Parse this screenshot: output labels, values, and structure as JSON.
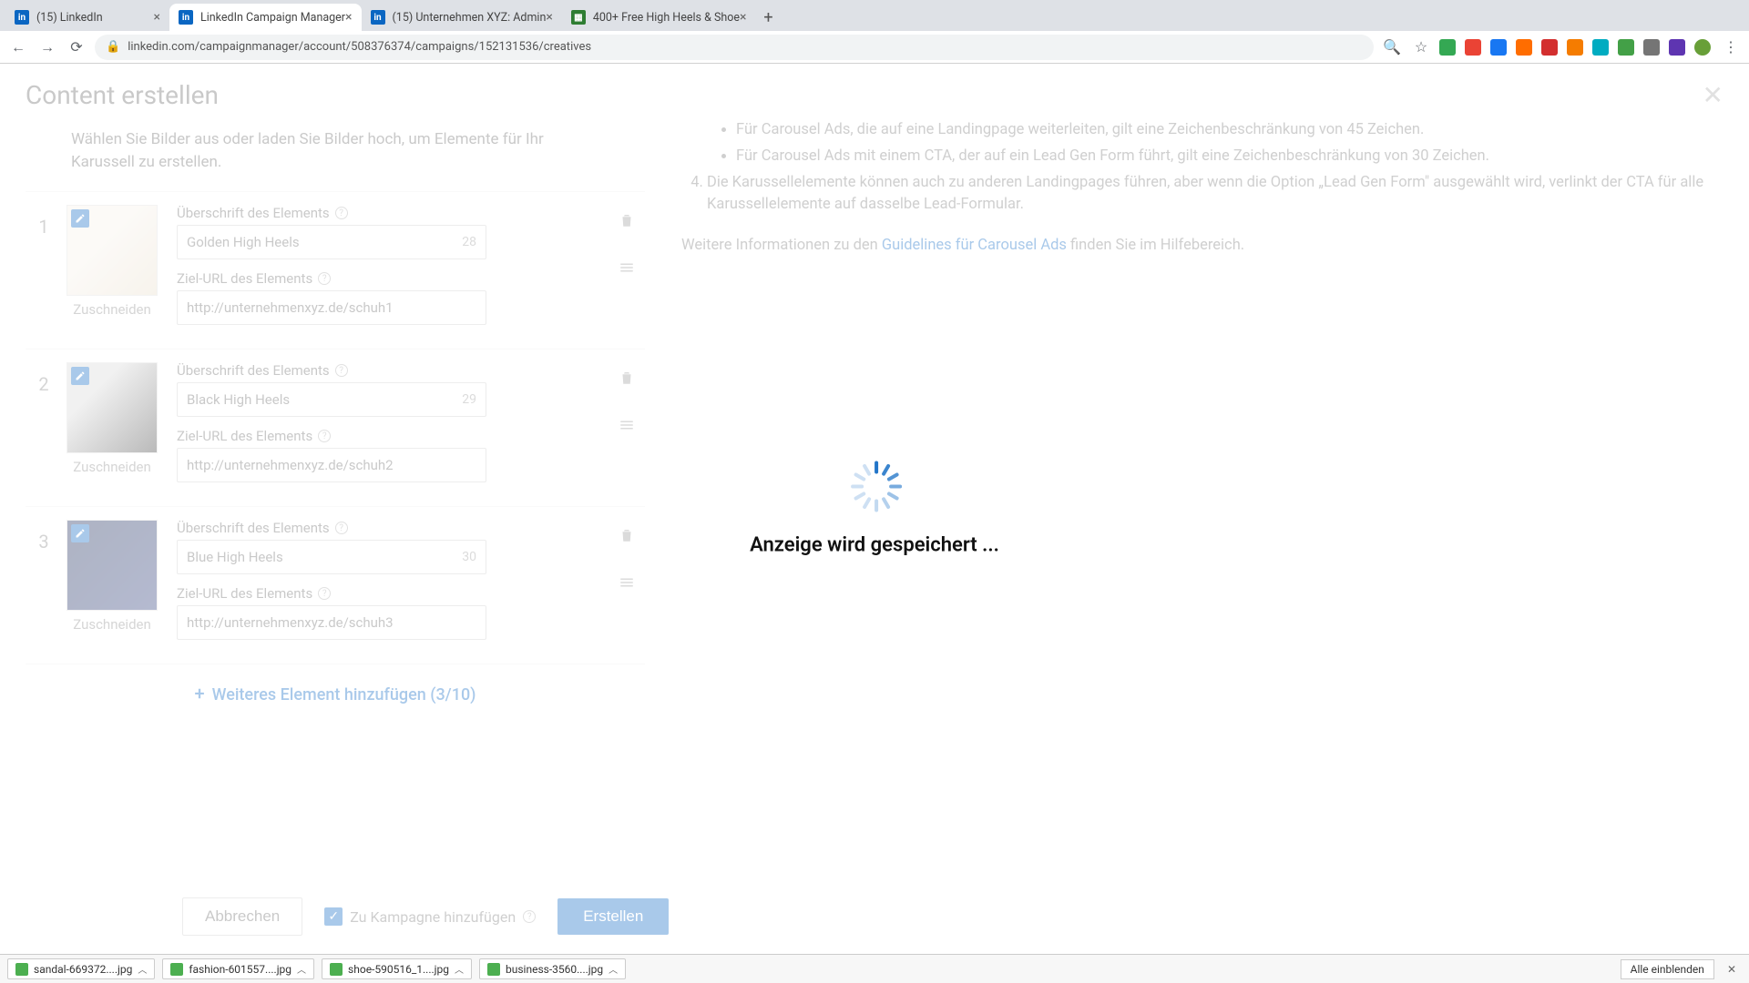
{
  "browser": {
    "tabs": [
      {
        "title": "(15) LinkedIn"
      },
      {
        "title": "LinkedIn Campaign Manager"
      },
      {
        "title": "(15) Unternehmen XYZ: Admin"
      },
      {
        "title": "400+ Free High Heels & Shoe"
      }
    ],
    "url": "linkedin.com/campaignmanager/account/508376374/campaigns/152131536/creatives"
  },
  "modal": {
    "title": "Content erstellen",
    "intro": "Wählen Sie Bilder aus oder laden Sie Bilder hoch, um Elemente für Ihr Karussell zu erstellen.",
    "headline_label": "Überschrift des Elements",
    "url_label": "Ziel-URL des Elements",
    "crop": "Zuschneiden",
    "items": [
      {
        "num": "1",
        "headline": "Golden High Heels",
        "count": "28",
        "url": "http://unternehmenxyz.de/schuh1"
      },
      {
        "num": "2",
        "headline": "Black High Heels",
        "count": "29",
        "url": "http://unternehmenxyz.de/schuh2"
      },
      {
        "num": "3",
        "headline": "Blue High Heels",
        "count": "30",
        "url": "http://unternehmenxyz.de/schuh3"
      }
    ],
    "add_more": "Weiteres Element hinzufügen (3/10)",
    "hints": {
      "bullet1": "Für Carousel Ads, die auf eine Landingpage weiterleiten, gilt eine Zeichenbeschränkung von 45 Zeichen.",
      "bullet2": "Für Carousel Ads mit einem CTA, der auf ein Lead Gen Form führt, gilt eine Zeichenbeschränkung von 30 Zeichen.",
      "num4": "Die Karussellelemente können auch zu anderen Landingpages führen, aber wenn die Option „Lead Gen Form\" ausgewählt wird, verlinkt der CTA für alle Karussellelemente auf dasselbe Lead-Formular.",
      "more_info_pre": "Weitere Informationen zu den ",
      "more_info_link": "Guidelines für Carousel Ads",
      "more_info_post": " finden Sie im Hilfebereich."
    },
    "footer": {
      "cancel": "Abbrechen",
      "add_to_campaign": "Zu Kampagne hinzufügen",
      "create": "Erstellen"
    }
  },
  "loading": {
    "text": "Anzeige wird gespeichert ..."
  },
  "downloads": {
    "items": [
      "sandal-669372....jpg",
      "fashion-601557....jpg",
      "shoe-590516_1....jpg",
      "business-3560....jpg"
    ],
    "show_all": "Alle einblenden"
  }
}
